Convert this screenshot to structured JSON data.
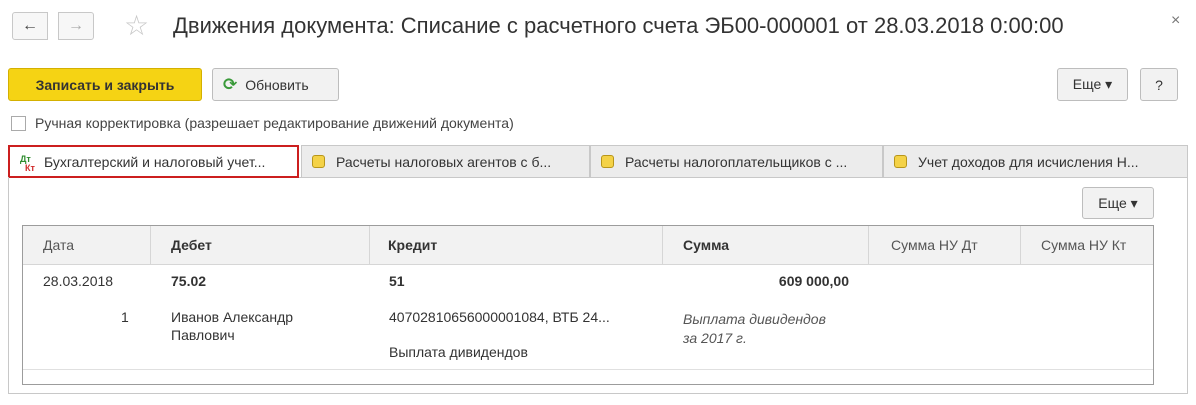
{
  "window": {
    "title": "Движения документа: Списание с расчетного счета ЭБ00-000001 от 28.03.2018 0:00:00",
    "close_glyph": "×"
  },
  "nav": {
    "back_glyph": "←",
    "forward_glyph": "→",
    "star_glyph": "☆"
  },
  "toolbar": {
    "save_close_label": "Записать и закрыть",
    "refresh_label": "Обновить",
    "refresh_glyph": "⟳",
    "more_label": "Еще ▾",
    "help_label": "?"
  },
  "manual_edit": {
    "label": "Ручная корректировка (разрешает редактирование движений документа)",
    "checked": false
  },
  "tabs": [
    {
      "label": "Бухгалтерский и налоговый учет...",
      "icon": "dt-kt-icon",
      "active": true
    },
    {
      "label": "Расчеты налоговых агентов с б...",
      "icon": "register-icon",
      "active": false
    },
    {
      "label": "Расчеты налогоплательщиков с ...",
      "icon": "register-icon",
      "active": false
    },
    {
      "label": "Учет доходов для исчисления Н...",
      "icon": "register-icon",
      "active": false
    }
  ],
  "tab_icon_text": {
    "dt": "Дт",
    "kt": "Кт"
  },
  "panel": {
    "more_label": "Еще ▾"
  },
  "table": {
    "columns": [
      "Дата",
      "Дебет",
      "Кредит",
      "Сумма",
      "Сумма НУ Дт",
      "Сумма НУ Кт"
    ],
    "rows": [
      {
        "date": "28.03.2018",
        "line_no": "1",
        "debit_account": "75.02",
        "debit_subconto": "Иванов Александр",
        "debit_subconto_2": "Павлович",
        "credit_account": "51",
        "credit_subconto": "40702810656000001084, ВТБ 24...",
        "credit_subconto_2": "Выплата дивидендов",
        "amount": "609 000,00",
        "content_line1": "Выплата дивидендов",
        "content_line2": "за 2017 г.",
        "nu_dt": "",
        "nu_kt": ""
      }
    ]
  }
}
